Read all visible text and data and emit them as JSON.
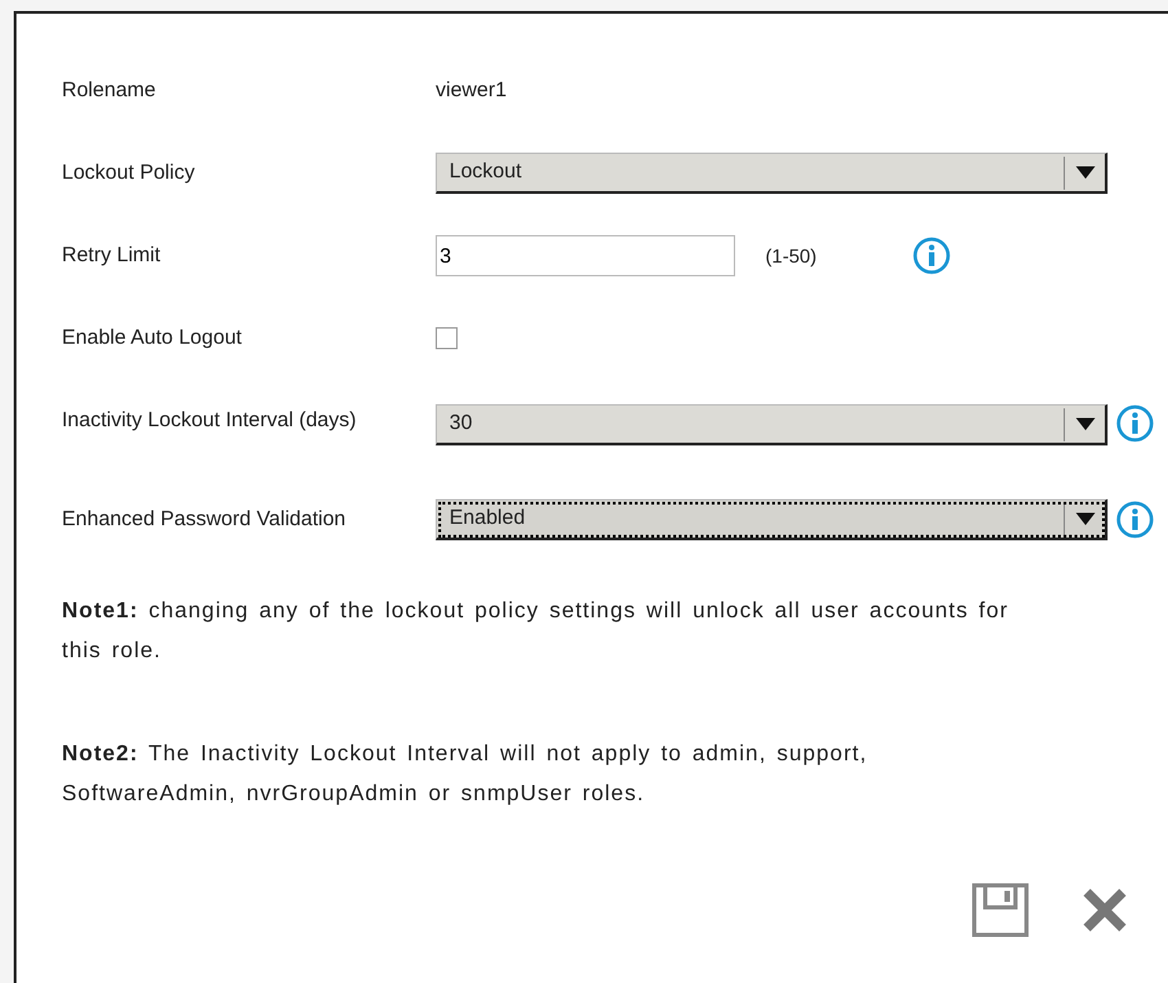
{
  "fields": [
    {
      "kind": "text",
      "label": "Rolename",
      "value": "viewer1"
    },
    {
      "kind": "select",
      "label": "Lockout Policy",
      "value": "Lockout",
      "focused": false
    },
    {
      "kind": "input",
      "label": "Retry Limit",
      "value": "3",
      "hint": "(1-50)",
      "info": true
    },
    {
      "kind": "checkbox",
      "label": "Enable Auto Logout",
      "checked": false
    },
    {
      "kind": "select",
      "label": "Inactivity Lockout Interval (days)",
      "value": "30",
      "focused": false,
      "info": true
    },
    {
      "kind": "select",
      "label": "Enhanced Password Validation",
      "value": "Enabled",
      "focused": true,
      "info": true
    }
  ],
  "notes": [
    "**Note1:** changing any of the lockout policy settings will unlock all user accounts for this role.",
    "**Note2:** The Inactivity Lockout Interval will not apply to admin, support, SoftwareAdmin, nvrGroupAdmin or snmpUser roles."
  ]
}
